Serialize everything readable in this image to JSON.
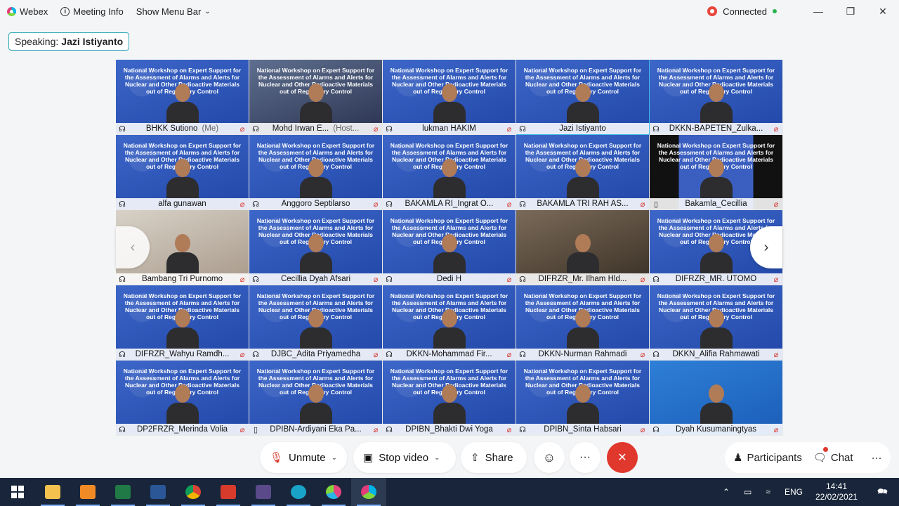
{
  "titlebar": {
    "app": "Webex",
    "meeting_info": "Meeting Info",
    "menu_bar": "Show Menu Bar",
    "status": "Connected"
  },
  "speaking": {
    "label": "Speaking:",
    "name": "Jazi Istiyanto"
  },
  "slide_text": "National Workshop on Expert Support for the Assessment of Alarms and Alerts for Nuclear and Other Radioactive Materials out of Regulatory Control",
  "participants": [
    {
      "name": "BHKK Sutiono",
      "suffix": "(Me)"
    },
    {
      "name": "Mohd Irwan E...",
      "suffix": "(Host..."
    },
    {
      "name": "lukman HAKIM",
      "suffix": ""
    },
    {
      "name": "Jazi Istiyanto",
      "suffix": ""
    },
    {
      "name": "DKKN-BAPETEN_Zulka...",
      "suffix": ""
    },
    {
      "name": "alfa gunawan",
      "suffix": ""
    },
    {
      "name": "Anggoro Septilarso",
      "suffix": ""
    },
    {
      "name": "BAKAMLA RI_Ingrat O...",
      "suffix": ""
    },
    {
      "name": "BAKAMLA TRI RAH AS...",
      "suffix": ""
    },
    {
      "name": "Bakamla_Cecillia",
      "suffix": ""
    },
    {
      "name": "Bambang Tri Purnomo",
      "suffix": ""
    },
    {
      "name": "Cecillia Dyah Afsari",
      "suffix": ""
    },
    {
      "name": "Dedi H",
      "suffix": ""
    },
    {
      "name": "DIFRZR_Mr. Ilham Hld...",
      "suffix": ""
    },
    {
      "name": "DIFRZR_MR. UTOMO",
      "suffix": ""
    },
    {
      "name": "DIFRZR_Wahyu Ramdh...",
      "suffix": ""
    },
    {
      "name": "DJBC_Adita Priyamedha",
      "suffix": ""
    },
    {
      "name": "DKKN-Mohammad Fir...",
      "suffix": ""
    },
    {
      "name": "DKKN-Nurman Rahmadi",
      "suffix": ""
    },
    {
      "name": "DKKN_Alifia Rahmawati",
      "suffix": ""
    },
    {
      "name": "DP2FRZR_Merinda Volia",
      "suffix": ""
    },
    {
      "name": "DPIBN-Ardiyani Eka Pa...",
      "suffix": ""
    },
    {
      "name": "DPIBN_Bhakti Dwi Yoga",
      "suffix": ""
    },
    {
      "name": "DPIBN_Sinta Habsari",
      "suffix": ""
    },
    {
      "name": "Dyah Kusumaningtyas",
      "suffix": ""
    }
  ],
  "controls": {
    "unmute": "Unmute",
    "stop_video": "Stop video",
    "share": "Share",
    "participants": "Participants",
    "chat": "Chat"
  },
  "taskbar": {
    "lang": "ENG",
    "time": "14:41",
    "date": "22/02/2021"
  },
  "colors": {
    "accent": "#3db9e8",
    "end_call": "#e0382d",
    "connected": "#2bb24c"
  }
}
